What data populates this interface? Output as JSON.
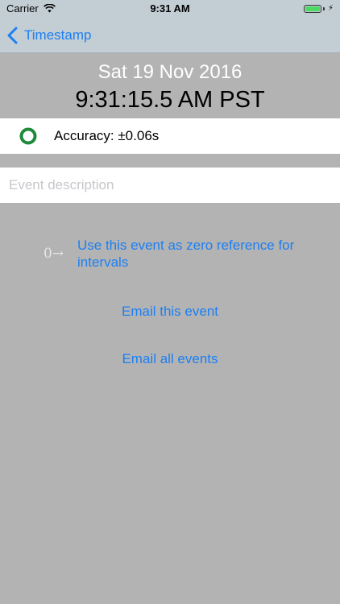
{
  "status_bar": {
    "carrier": "Carrier",
    "time": "9:31 AM",
    "battery_color": "#4cd964"
  },
  "nav": {
    "back_label": "Timestamp",
    "tint_color": "#1d7ff2"
  },
  "header": {
    "date": "Sat 19 Nov 2016",
    "time": "9:31:15.5 AM PST"
  },
  "accuracy": {
    "label": "Accuracy: ±0.06s",
    "status_color": "#1e8a3a",
    "icon": "ring-icon"
  },
  "event": {
    "placeholder": "Event description",
    "value": ""
  },
  "actions": {
    "zero_reference_icon": "0→",
    "zero_reference_label": "Use this event as zero reference for intervals",
    "email_event_label": "Email this event",
    "email_all_label": "Email all events"
  }
}
